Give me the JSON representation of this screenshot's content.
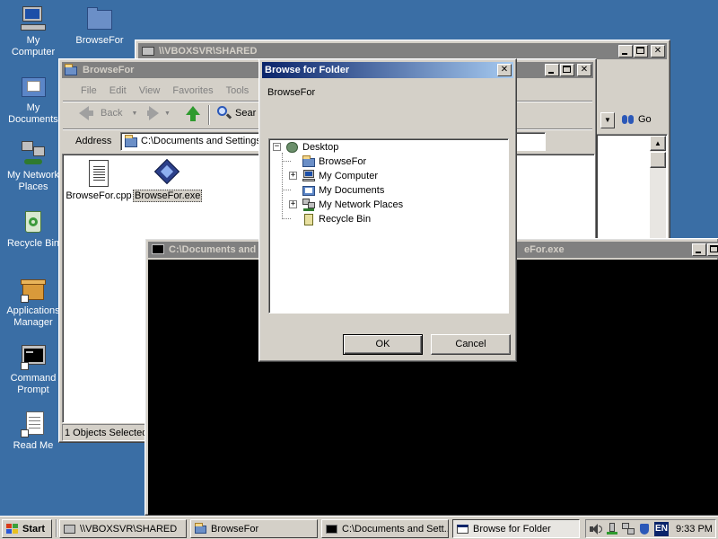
{
  "desktop": {
    "icons": [
      {
        "label": "My\nComputer"
      },
      {
        "label": "BrowseFor"
      },
      {
        "label": "My\nDocuments"
      },
      {
        "label": "My Network\nPlaces"
      },
      {
        "label": "Recycle Bin"
      },
      {
        "label": "Applications\nManager"
      },
      {
        "label": "Command\nPrompt"
      },
      {
        "label": "Read Me"
      }
    ]
  },
  "shared_window": {
    "title": "\\\\VBOXSVR\\SHARED",
    "go_label": "Go"
  },
  "explorer": {
    "title": "BrowseFor",
    "menu": [
      "File",
      "Edit",
      "View",
      "Favorites",
      "Tools"
    ],
    "toolbar": {
      "back_label": "Back",
      "search_label": "Sear"
    },
    "address_label": "Address",
    "address_value": "C:\\Documents and Settings\\",
    "go_label": "Go",
    "files": [
      {
        "name": "BrowseFor.cpp"
      },
      {
        "name": "BrowseFor.exe"
      }
    ],
    "status": "1 Objects Selected"
  },
  "console": {
    "title": "C:\\Documents and",
    "title_tail": "eFor.exe"
  },
  "dialog": {
    "title": "Browse for Folder",
    "caption": "BrowseFor",
    "tree": [
      {
        "label": "Desktop",
        "expander": "−"
      },
      {
        "label": "BrowseFor",
        "expander": ""
      },
      {
        "label": "My Computer",
        "expander": "+"
      },
      {
        "label": "My Documents",
        "expander": ""
      },
      {
        "label": "My Network Places",
        "expander": "+"
      },
      {
        "label": "Recycle Bin",
        "expander": ""
      }
    ],
    "ok_label": "OK",
    "cancel_label": "Cancel",
    "close_glyph": "✕"
  },
  "taskbar": {
    "start_label": "Start",
    "tasks": [
      {
        "label": "\\\\VBOXSVR\\SHARED"
      },
      {
        "label": "BrowseFor"
      },
      {
        "label": "C:\\Documents and Sett..."
      },
      {
        "label": "Browse for Folder"
      }
    ],
    "language": "EN",
    "clock": "9:33 PM"
  },
  "colors": {
    "desktop": "#3a6ea5",
    "active_title": "#0a246a",
    "inactive_title": "#808080",
    "face": "#d4d0c8",
    "console_bg": "#000000"
  },
  "icons": [
    "my-computer-icon",
    "folder-icon",
    "my-documents-icon",
    "network-places-icon",
    "recycle-bin-icon",
    "applications-manager-icon",
    "command-prompt-icon",
    "read-me-icon"
  ]
}
